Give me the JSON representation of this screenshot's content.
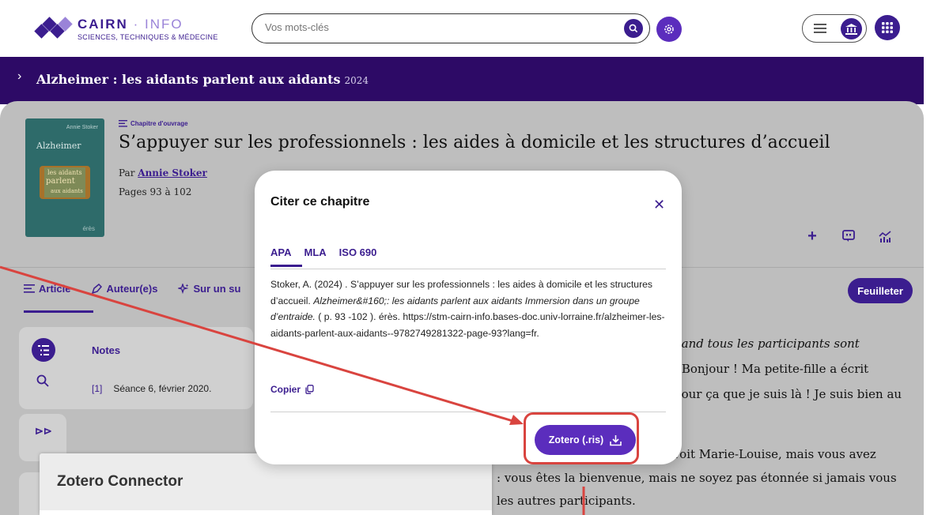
{
  "header": {
    "logo_name": "CAIRN",
    "logo_sep": "·",
    "logo_info": "INFO",
    "logo_sub": "SCIENCES, TECHNIQUES & MÉDECINE",
    "search_placeholder": "Vos mots-clés"
  },
  "band": {
    "book_title": "Alzheimer : les aidants parlent aux aidants",
    "year": "2024"
  },
  "cover": {
    "author": "Annie Stoker",
    "title": "Alzheimer",
    "line1": "les aidants",
    "line2": "parlent",
    "line3": "aux aidants",
    "publisher": "érès"
  },
  "chapter": {
    "type": "Chapitre d'ouvrage",
    "title": "S’appuyer sur les professionnels : les aides à domicile et les structures d’accueil",
    "by_label": "Par",
    "author": "Annie Stoker",
    "pages": "Pages 93 à 102"
  },
  "tabs": {
    "article": "Article",
    "authors": "Auteur(e)s",
    "topic": "Sur un su"
  },
  "feuilleter": "Feuilleter",
  "notes": {
    "heading": "Notes",
    "num": "[1]",
    "text": "Séance 6, février 2020."
  },
  "body_lines": [
    "uand tous les participants sont",
    "- Bonjour ! Ma petite-fille a écrit",
    "pour ça que je suis là ! Je suis bien au",
    "roit Marie-Louise, mais vous avez",
    ": vous êtes la bienvenue, mais ne soyez pas étonnée si jamais vous",
    "les autres participants."
  ],
  "modal": {
    "title": "Citer ce chapitre",
    "formats": [
      "APA",
      "MLA",
      "ISO 690"
    ],
    "citation_plain": "Stoker, A. (2024) . S’appuyer sur les professionnels : les aides à domicile et les structures d’accueil. ",
    "citation_italic": "Alzheimer&#160;: les aidants parlent aux aidants Immersion dans un groupe d’entraide.",
    "citation_rest": " ( p. 93 -102 ). érès. https://stm-cairn-info.bases-doc.univ-lorraine.fr/alzheimer-les-aidants-parlent-aux-aidants--9782749281322-page-93?lang=fr.",
    "copy_label": "Copier",
    "zotero_button": "Zotero (.ris)"
  },
  "zotero_popup": {
    "title": "Zotero Connector"
  },
  "colors": {
    "brand_purple": "#3b1d8f",
    "band_purple": "#2d0a66",
    "button_purple": "#5b2dbd",
    "annotation_red": "#d9443f"
  }
}
